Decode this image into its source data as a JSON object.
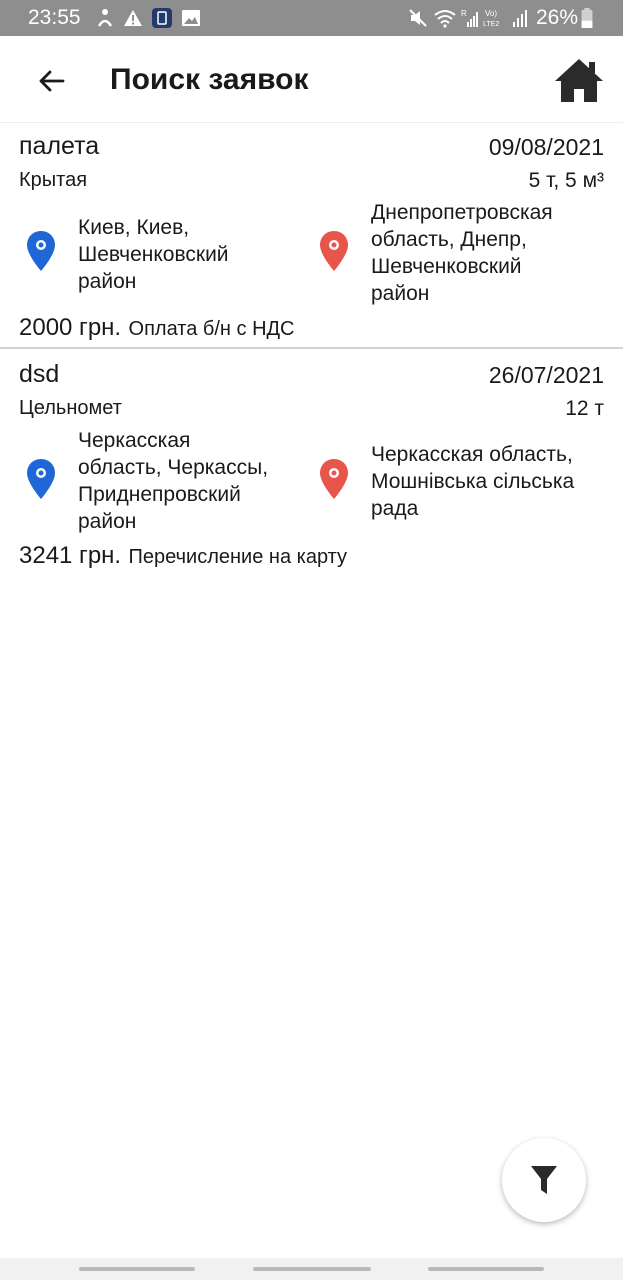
{
  "status_bar": {
    "time": "23:55",
    "battery": "26%",
    "icons": [
      "gesture-icon",
      "warning-icon",
      "app-notification-icon",
      "image-icon",
      "mute-icon",
      "wifi-icon",
      "signal-r-icon",
      "volte-icon",
      "signal-icon",
      "battery-icon"
    ]
  },
  "header": {
    "title": "Поиск заявок",
    "back_icon": "arrow-left-icon",
    "home_icon": "home-icon"
  },
  "orders": [
    {
      "cargo": "палета",
      "date": "09/08/2021",
      "body_type": "Крытая",
      "weight": "5 т, 5 м³",
      "from": [
        "Киев, Киев,",
        "Шевченковский",
        "район"
      ],
      "to": [
        "Днепропетровская",
        "область, Днепр,",
        "Шевченковский",
        "район"
      ],
      "price": "2000 грн.",
      "payment": "Оплата б/н с НДС"
    },
    {
      "cargo": "dsd",
      "date": "26/07/2021",
      "body_type": "Цельномет",
      "weight": "12 т",
      "from": [
        "Черкасская",
        "область, Черкассы,",
        "Приднепровский",
        "район"
      ],
      "to": [
        "Черкасская область,",
        "Мошнівська сільська",
        "рада"
      ],
      "price": "3241 грн.",
      "payment": "Перечисление на карту"
    }
  ],
  "filter_button": {
    "icon": "filter-icon"
  },
  "colors": {
    "origin_pin": "#1f66d6",
    "destination_pin": "#e8554a",
    "status_bar": "#8e8e8e",
    "divider": "#cbd5de"
  }
}
